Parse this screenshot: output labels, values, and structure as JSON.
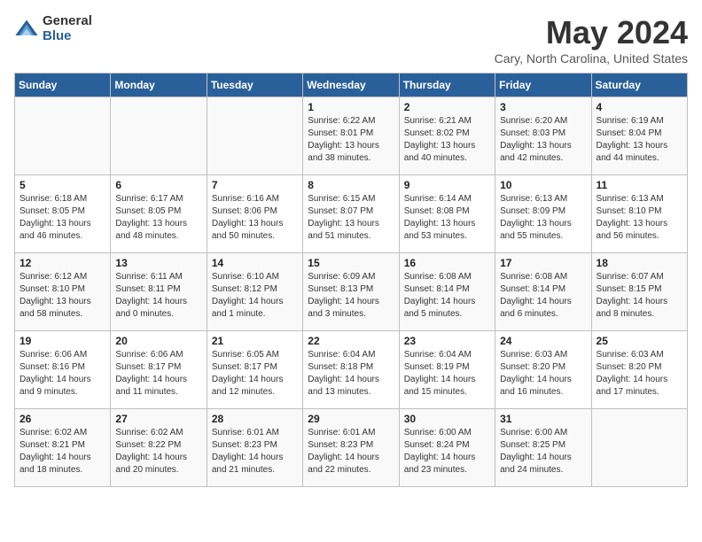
{
  "logo": {
    "general": "General",
    "blue": "Blue"
  },
  "title": "May 2024",
  "location": "Cary, North Carolina, United States",
  "days_header": [
    "Sunday",
    "Monday",
    "Tuesday",
    "Wednesday",
    "Thursday",
    "Friday",
    "Saturday"
  ],
  "weeks": [
    [
      {
        "num": "",
        "info": ""
      },
      {
        "num": "",
        "info": ""
      },
      {
        "num": "",
        "info": ""
      },
      {
        "num": "1",
        "info": "Sunrise: 6:22 AM\nSunset: 8:01 PM\nDaylight: 13 hours\nand 38 minutes."
      },
      {
        "num": "2",
        "info": "Sunrise: 6:21 AM\nSunset: 8:02 PM\nDaylight: 13 hours\nand 40 minutes."
      },
      {
        "num": "3",
        "info": "Sunrise: 6:20 AM\nSunset: 8:03 PM\nDaylight: 13 hours\nand 42 minutes."
      },
      {
        "num": "4",
        "info": "Sunrise: 6:19 AM\nSunset: 8:04 PM\nDaylight: 13 hours\nand 44 minutes."
      }
    ],
    [
      {
        "num": "5",
        "info": "Sunrise: 6:18 AM\nSunset: 8:05 PM\nDaylight: 13 hours\nand 46 minutes."
      },
      {
        "num": "6",
        "info": "Sunrise: 6:17 AM\nSunset: 8:05 PM\nDaylight: 13 hours\nand 48 minutes."
      },
      {
        "num": "7",
        "info": "Sunrise: 6:16 AM\nSunset: 8:06 PM\nDaylight: 13 hours\nand 50 minutes."
      },
      {
        "num": "8",
        "info": "Sunrise: 6:15 AM\nSunset: 8:07 PM\nDaylight: 13 hours\nand 51 minutes."
      },
      {
        "num": "9",
        "info": "Sunrise: 6:14 AM\nSunset: 8:08 PM\nDaylight: 13 hours\nand 53 minutes."
      },
      {
        "num": "10",
        "info": "Sunrise: 6:13 AM\nSunset: 8:09 PM\nDaylight: 13 hours\nand 55 minutes."
      },
      {
        "num": "11",
        "info": "Sunrise: 6:13 AM\nSunset: 8:10 PM\nDaylight: 13 hours\nand 56 minutes."
      }
    ],
    [
      {
        "num": "12",
        "info": "Sunrise: 6:12 AM\nSunset: 8:10 PM\nDaylight: 13 hours\nand 58 minutes."
      },
      {
        "num": "13",
        "info": "Sunrise: 6:11 AM\nSunset: 8:11 PM\nDaylight: 14 hours\nand 0 minutes."
      },
      {
        "num": "14",
        "info": "Sunrise: 6:10 AM\nSunset: 8:12 PM\nDaylight: 14 hours\nand 1 minute."
      },
      {
        "num": "15",
        "info": "Sunrise: 6:09 AM\nSunset: 8:13 PM\nDaylight: 14 hours\nand 3 minutes."
      },
      {
        "num": "16",
        "info": "Sunrise: 6:08 AM\nSunset: 8:14 PM\nDaylight: 14 hours\nand 5 minutes."
      },
      {
        "num": "17",
        "info": "Sunrise: 6:08 AM\nSunset: 8:14 PM\nDaylight: 14 hours\nand 6 minutes."
      },
      {
        "num": "18",
        "info": "Sunrise: 6:07 AM\nSunset: 8:15 PM\nDaylight: 14 hours\nand 8 minutes."
      }
    ],
    [
      {
        "num": "19",
        "info": "Sunrise: 6:06 AM\nSunset: 8:16 PM\nDaylight: 14 hours\nand 9 minutes."
      },
      {
        "num": "20",
        "info": "Sunrise: 6:06 AM\nSunset: 8:17 PM\nDaylight: 14 hours\nand 11 minutes."
      },
      {
        "num": "21",
        "info": "Sunrise: 6:05 AM\nSunset: 8:17 PM\nDaylight: 14 hours\nand 12 minutes."
      },
      {
        "num": "22",
        "info": "Sunrise: 6:04 AM\nSunset: 8:18 PM\nDaylight: 14 hours\nand 13 minutes."
      },
      {
        "num": "23",
        "info": "Sunrise: 6:04 AM\nSunset: 8:19 PM\nDaylight: 14 hours\nand 15 minutes."
      },
      {
        "num": "24",
        "info": "Sunrise: 6:03 AM\nSunset: 8:20 PM\nDaylight: 14 hours\nand 16 minutes."
      },
      {
        "num": "25",
        "info": "Sunrise: 6:03 AM\nSunset: 8:20 PM\nDaylight: 14 hours\nand 17 minutes."
      }
    ],
    [
      {
        "num": "26",
        "info": "Sunrise: 6:02 AM\nSunset: 8:21 PM\nDaylight: 14 hours\nand 18 minutes."
      },
      {
        "num": "27",
        "info": "Sunrise: 6:02 AM\nSunset: 8:22 PM\nDaylight: 14 hours\nand 20 minutes."
      },
      {
        "num": "28",
        "info": "Sunrise: 6:01 AM\nSunset: 8:23 PM\nDaylight: 14 hours\nand 21 minutes."
      },
      {
        "num": "29",
        "info": "Sunrise: 6:01 AM\nSunset: 8:23 PM\nDaylight: 14 hours\nand 22 minutes."
      },
      {
        "num": "30",
        "info": "Sunrise: 6:00 AM\nSunset: 8:24 PM\nDaylight: 14 hours\nand 23 minutes."
      },
      {
        "num": "31",
        "info": "Sunrise: 6:00 AM\nSunset: 8:25 PM\nDaylight: 14 hours\nand 24 minutes."
      },
      {
        "num": "",
        "info": ""
      }
    ]
  ]
}
